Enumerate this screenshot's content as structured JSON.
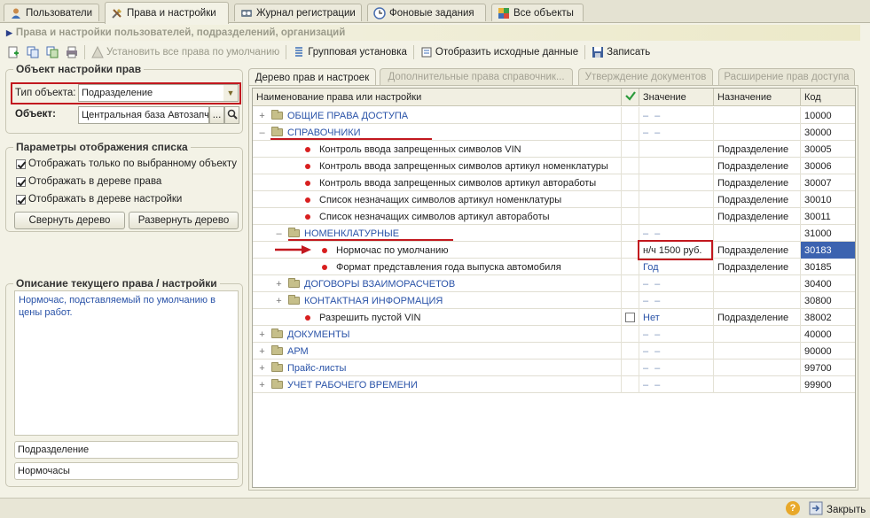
{
  "top_tabs": [
    {
      "label": "Пользователи",
      "icon": "user-icon"
    },
    {
      "label": "Права и настройки",
      "icon": "tools-icon"
    },
    {
      "label": "Журнал регистрации",
      "icon": "log-icon"
    },
    {
      "label": "Фоновые задания",
      "icon": "clock-icon"
    },
    {
      "label": "Все объекты",
      "icon": "objects-icon"
    }
  ],
  "header": {
    "title": "Права и настройки пользователей, подразделений, организаций"
  },
  "toolbar": {
    "set_defaults_label": "Установить все права по умолчанию",
    "group_set_label": "Групповая установка",
    "show_source_label": "Отобразить исходные данные",
    "save_label": "Записать"
  },
  "rights_object": {
    "title": "Объект настройки прав",
    "type_label": "Тип объекта:",
    "type_value": "Подразделение",
    "object_label": "Объект:",
    "object_value": "Центральная база Автозапч",
    "browse_label": "..."
  },
  "list_params": {
    "title": "Параметры отображения списка",
    "options": [
      {
        "label": "Отображать только по  выбранному объекту",
        "checked": true
      },
      {
        "label": "Отображать в дереве права",
        "checked": true
      },
      {
        "label": "Отображать в дереве настройки",
        "checked": true
      }
    ],
    "collapse_label": "Свернуть дерево",
    "expand_label": "Развернуть дерево"
  },
  "description": {
    "title": "Описание текущего права / настройки",
    "text": "Нормочас, подставляемый по умолчанию в цены работ.",
    "field1": "Подразделение",
    "field2": "Нормочасы"
  },
  "inner_tabs": [
    {
      "label": "Дерево прав и настроек",
      "active": true
    },
    {
      "label": "Дополнительные права справочник...",
      "active": false
    },
    {
      "label": "Утверждение документов",
      "active": false
    },
    {
      "label": "Расширение прав доступа",
      "active": false
    }
  ],
  "table": {
    "columns": [
      "Наименование права или настройки",
      "",
      "Значение",
      "Назначение",
      "Код"
    ],
    "rows": [
      {
        "level": 0,
        "kind": "folder",
        "expand": "+",
        "name": "ОБЩИЕ ПРАВА ДОСТУПА",
        "value": "– –",
        "purpose": "",
        "code": "10000"
      },
      {
        "level": 0,
        "kind": "folder",
        "expand": "–",
        "name": "СПРАВОЧНИКИ",
        "value": "– –",
        "purpose": "",
        "code": "30000"
      },
      {
        "level": 1,
        "kind": "item",
        "name": "Контроль ввода запрещенных символов VIN",
        "value": "",
        "purpose": "Подразделение",
        "code": "30005"
      },
      {
        "level": 1,
        "kind": "item",
        "name": "Контроль ввода запрещенных символов артикул номенклатуры",
        "value": "",
        "purpose": "Подразделение",
        "code": "30006"
      },
      {
        "level": 1,
        "kind": "item",
        "name": "Контроль ввода запрещенных символов артикул автоработы",
        "value": "",
        "purpose": "Подразделение",
        "code": "30007"
      },
      {
        "level": 1,
        "kind": "item",
        "name": "Список незначащих символов артикул номенклатуры",
        "value": "",
        "purpose": "Подразделение",
        "code": "30010"
      },
      {
        "level": 1,
        "kind": "item",
        "name": "Список незначащих символов артикул автоработы",
        "value": "",
        "purpose": "Подразделение",
        "code": "30011"
      },
      {
        "level": 1,
        "kind": "folder",
        "expand": "–",
        "name": "НОМЕНКЛАТУРНЫЕ",
        "value": "– –",
        "purpose": "",
        "code": "31000"
      },
      {
        "level": 2,
        "kind": "item",
        "name": "Нормочас по умолчанию",
        "value": "н/ч 1500 руб.",
        "purpose": "Подразделение",
        "code": "30183",
        "selected": true
      },
      {
        "level": 2,
        "kind": "item",
        "name": "Формат представления года выпуска автомобиля",
        "value": "Год",
        "purpose": "Подразделение",
        "code": "30185"
      },
      {
        "level": 1,
        "kind": "folder",
        "expand": "+",
        "name": "ДОГОВОРЫ ВЗАИМОРАСЧЕТОВ",
        "value": "– –",
        "purpose": "",
        "code": "30400"
      },
      {
        "level": 1,
        "kind": "folder",
        "expand": "+",
        "name": "КОНТАКТНАЯ ИНФОРМАЦИЯ",
        "value": "– –",
        "purpose": "",
        "code": "30800"
      },
      {
        "level": 1,
        "kind": "item",
        "name": "Разрешить пустой VIN",
        "value": "Нет",
        "checkbox": true,
        "purpose": "Подразделение",
        "code": "38002"
      },
      {
        "level": 0,
        "kind": "folder",
        "expand": "+",
        "name": "ДОКУМЕНТЫ",
        "value": "– –",
        "purpose": "",
        "code": "40000"
      },
      {
        "level": 0,
        "kind": "folder",
        "expand": "+",
        "name": "АРМ",
        "value": "– –",
        "purpose": "",
        "code": "90000"
      },
      {
        "level": 0,
        "kind": "folder",
        "expand": "+",
        "name": "Прайс-листы",
        "value": "– –",
        "purpose": "",
        "code": "99700"
      },
      {
        "level": 0,
        "kind": "folder",
        "expand": "+",
        "name": "УЧЕТ РАБОЧЕГО ВРЕМЕНИ",
        "value": "– –",
        "purpose": "",
        "code": "99900"
      }
    ]
  },
  "status": {
    "close_label": "Закрыть"
  },
  "colors": {
    "highlight": "#c2181f",
    "link": "#2a53a8",
    "selected_cell": "#3c63b0"
  }
}
